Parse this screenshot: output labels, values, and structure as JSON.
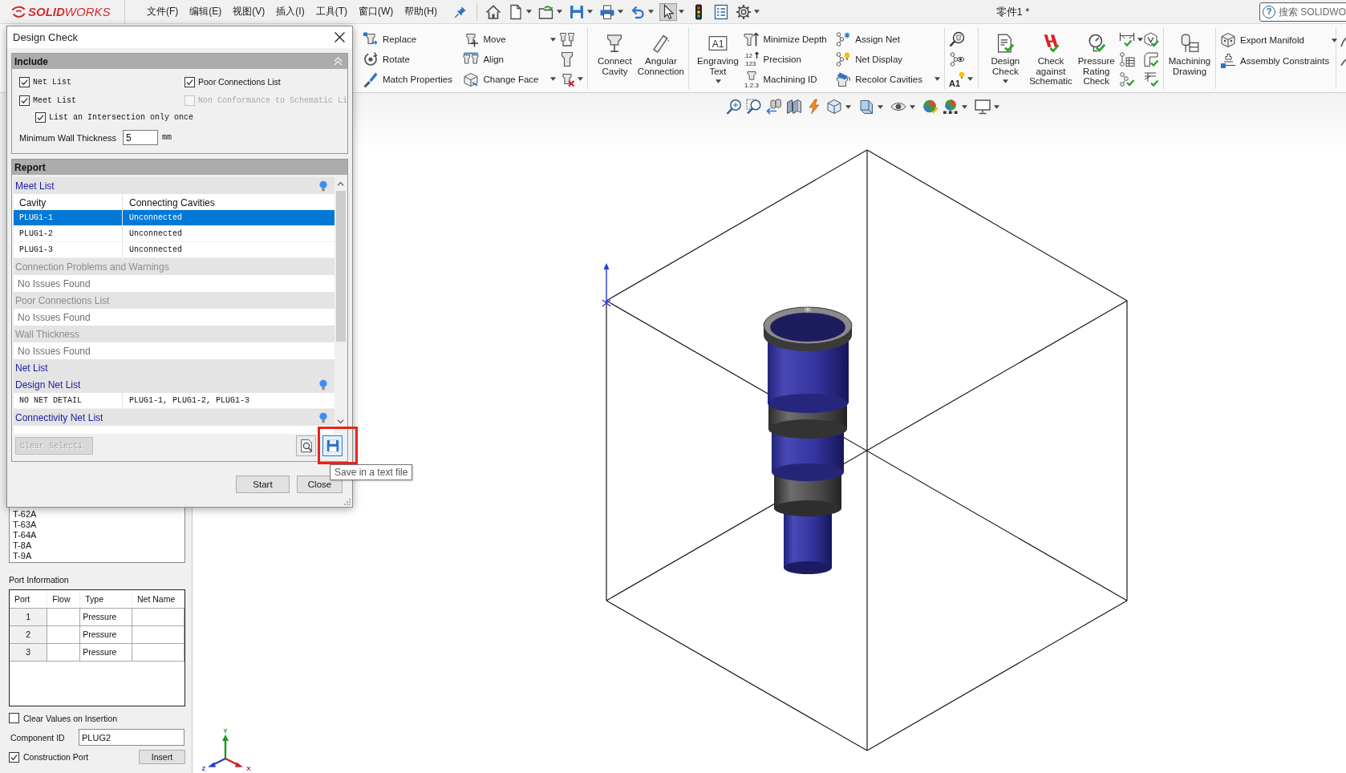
{
  "title_bar": {
    "logo": "**SOLID**WORKS",
    "menus": [
      "文件(F)",
      "编辑(E)",
      "视图(V)",
      "插入(I)",
      "工具(T)",
      "窗口(W)",
      "帮助(H)"
    ],
    "tools": [
      {
        "kind": "home",
        "dropdown": false,
        "selected": false
      },
      {
        "kind": "new",
        "dropdown": true,
        "selected": false
      },
      {
        "kind": "open",
        "dropdown": true,
        "selected": false
      },
      {
        "kind": "save",
        "dropdown": true,
        "selected": false
      },
      {
        "kind": "print",
        "dropdown": true,
        "selected": false
      },
      {
        "kind": "undo",
        "dropdown": true,
        "selected": false
      },
      {
        "kind": "select",
        "dropdown": true,
        "selected": true
      },
      {
        "kind": "rebuild",
        "dropdown": false,
        "selected": false
      },
      {
        "kind": "properties",
        "dropdown": false,
        "selected": false
      },
      {
        "kind": "options",
        "dropdown": true,
        "selected": false
      }
    ],
    "title": "零件1 *",
    "search": {
      "help": "?",
      "placeholder": "搜索 SOLIDWO"
    }
  },
  "ribbon": {
    "groups": [
      {
        "columns": [
          {
            "kind": "small",
            "items": [
              {
                "kind": "replace",
                "label": "Replace",
                "dropdown": false
              },
              {
                "kind": "rotate",
                "label": "Rotate",
                "dropdown": false
              },
              {
                "kind": "match",
                "label": "Match Properties",
                "dropdown": false
              }
            ]
          },
          {
            "kind": "small",
            "items": [
              {
                "kind": "move",
                "label": "Move",
                "dropdown": true
              },
              {
                "kind": "align",
                "label": "Align",
                "dropdown": false
              },
              {
                "kind": "face",
                "label": "Change Face",
                "dropdown": true
              }
            ]
          },
          {
            "kind": "small",
            "items": [
              {
                "kind": "pair",
                "dropdown": false
              },
              {
                "kind": "cup",
                "dropdown": false
              },
              {
                "kind": "remove",
                "dropdown": true
              }
            ]
          }
        ]
      },
      {
        "columns": [
          {
            "kind": "large",
            "items": [
              {
                "kind": "connect",
                "label": "Connect Cavity",
                "dropdown": false
              }
            ]
          },
          {
            "kind": "large",
            "items": [
              {
                "kind": "angular",
                "label": "Angular Connection",
                "dropdown": false
              }
            ]
          }
        ]
      },
      {
        "columns": [
          {
            "kind": "large",
            "items": [
              {
                "kind": "engrave",
                "label": "Engraving Text",
                "icon_lines": [
                  "A1"
                ],
                "dropdown": true
              }
            ]
          },
          {
            "kind": "small",
            "items": [
              {
                "kind": "depth",
                "label": "Minimize Depth",
                "dropdown": false
              },
              {
                "kind": "precision",
                "label": "Precision",
                "icon_lines": [
                  ".12",
                  ".123"
                ],
                "dropdown": false
              },
              {
                "kind": "numbering",
                "label": "Machining ID",
                "icon_lines": [
                  "1.2.3"
                ],
                "dropdown": false
              }
            ]
          },
          {
            "kind": "small",
            "items": [
              {
                "kind": "assign",
                "label": "Assign Net",
                "dropdown": false
              },
              {
                "kind": "netdisplay",
                "label": "Net Display",
                "dropdown": false
              },
              {
                "kind": "recolor",
                "label": "Recolor Cavities",
                "dropdown": true
              }
            ]
          }
        ]
      },
      {
        "columns": [
          {
            "kind": "small",
            "items": [
              {
                "kind": "find",
                "dropdown": false
              },
              {
                "kind": "watch",
                "dropdown": false
              },
              {
                "kind": "annotate",
                "icon_lines": [
                  "A1"
                ],
                "dropdown": true
              }
            ]
          }
        ]
      },
      {
        "columns": [
          {
            "kind": "large",
            "items": [
              {
                "kind": "check",
                "label": "Design Check",
                "dropdown": true
              }
            ]
          },
          {
            "kind": "large",
            "items": [
              {
                "kind": "schematic",
                "label": "Check against Schematic",
                "dropdown": false
              }
            ]
          },
          {
            "kind": "large",
            "items": [
              {
                "kind": "pressure",
                "label": "Pressure Rating Check",
                "dropdown": false
              }
            ]
          },
          {
            "kind": "small",
            "items": [
              {
                "kind": "dimension",
                "dropdown": true
              },
              {
                "kind": "nettable",
                "dropdown": false
              },
              {
                "kind": "netcheck",
                "dropdown": false
              }
            ]
          },
          {
            "kind": "small",
            "items": [
              {
                "kind": "cube",
                "dropdown": false
              },
              {
                "kind": "pipe",
                "dropdown": false
              },
              {
                "kind": "hatch",
                "dropdown": false
              }
            ]
          }
        ]
      },
      {
        "columns": [
          {
            "kind": "large",
            "items": [
              {
                "kind": "drawing",
                "label": "Machining Drawing",
                "dropdown": false
              }
            ]
          }
        ]
      },
      {
        "columns": [
          {
            "kind": "small",
            "items": [
              {
                "kind": "export",
                "label": "Export Manifold",
                "dropdown": true
              },
              {
                "kind": "constraints",
                "label": "Assembly Constraints",
                "dropdown": false
              }
            ]
          }
        ]
      },
      {
        "columns": [
          {
            "kind": "small",
            "items": [
              {
                "kind": "sketch",
                "dropdown": false
              },
              {
                "kind": "curve",
                "dropdown": false
              }
            ]
          }
        ]
      }
    ]
  },
  "design_check": {
    "title": "Design Check",
    "include": {
      "title": "Include",
      "expanded": true,
      "columns": [
        {
          "options": [
            {
              "label": "Net List",
              "checked": true,
              "disabled": false
            },
            {
              "label": "Meet List",
              "checked": true,
              "disabled": false,
              "children": [
                {
                  "label": "List an Intersection only once",
                  "checked": true,
                  "disabled": false
                }
              ]
            }
          ]
        },
        {
          "options": [
            {
              "label": "Poor Connections List",
              "checked": true,
              "disabled": false
            },
            {
              "label": "Non Conformance to Schematic Li",
              "checked": false,
              "disabled": true
            }
          ]
        }
      ],
      "wall_thickness": {
        "label": "Minimum Wall Thickness",
        "value": "5",
        "unit": "mm"
      }
    },
    "report": {
      "title": "Report",
      "sections": [
        {
          "kind": "heading",
          "label": "Meet List",
          "disabled": false,
          "icon": true
        },
        {
          "kind": "table",
          "columns": [
            "Cavity",
            "Connecting Cavities"
          ],
          "rows": [
            {
              "cells": [
                "PLUG1-1",
                "Unconnected"
              ],
              "selected": true
            },
            {
              "cells": [
                "PLUG1-2",
                "Unconnected"
              ],
              "selected": false
            },
            {
              "cells": [
                "PLUG1-3",
                "Unconnected"
              ],
              "selected": false
            }
          ]
        },
        {
          "kind": "heading",
          "label": "Connection Problems and Warnings",
          "disabled": true,
          "icon": false
        },
        {
          "kind": "message",
          "text": "No Issues Found"
        },
        {
          "kind": "heading",
          "label": "Poor Connections List",
          "disabled": true,
          "icon": false
        },
        {
          "kind": "message",
          "text": "No Issues Found"
        },
        {
          "kind": "heading",
          "label": "Wall Thickness",
          "disabled": true,
          "icon": false
        },
        {
          "kind": "message",
          "text": "No Issues Found"
        },
        {
          "kind": "heading",
          "label": "Net List",
          "disabled": false,
          "icon": false
        },
        {
          "kind": "heading",
          "label": "Design Net List",
          "disabled": false,
          "icon": true
        },
        {
          "kind": "table",
          "rows": [
            {
              "cells": [
                "NO NET DETAIL",
                "PLUG1-1, PLUG1-2, PLUG1-3"
              ],
              "selected": false
            }
          ]
        },
        {
          "kind": "heading",
          "label": "Connectivity Net List",
          "disabled": false,
          "icon": true
        }
      ],
      "clear_selection": {
        "label": "Clear Selecti",
        "disabled": true
      },
      "tools": [
        {
          "kind": "preview",
          "hovered": false,
          "highlighted": false
        },
        {
          "kind": "save",
          "hovered": true,
          "highlighted": true,
          "tooltip": "Save in a text file"
        }
      ]
    },
    "buttons": [
      "Start",
      "Close"
    ]
  },
  "property_panel": {
    "list_items": [
      "T-62A",
      "T-63A",
      "T-64A",
      "T-8A",
      "T-9A"
    ],
    "port_information": {
      "title": "Port Information",
      "columns": [
        "Port",
        "Flow",
        "Type",
        "Net Name"
      ],
      "rows": [
        {
          "port": "1",
          "type": "Pressure"
        },
        {
          "port": "2",
          "type": "Pressure"
        },
        {
          "port": "3",
          "type": "Pressure"
        }
      ]
    },
    "clear_values": {
      "label": "Clear Values on Insertion",
      "checked": false
    },
    "component_id": {
      "label": "Component ID",
      "value": "PLUG2"
    },
    "construction_port": {
      "label": "Construction Port",
      "checked": true
    },
    "insert_button": "Insert"
  },
  "viewport": {
    "view_tools": [
      {
        "kind": "fit",
        "dropdown": false
      },
      {
        "kind": "area",
        "dropdown": false
      },
      {
        "kind": "previous",
        "dropdown": false
      },
      {
        "kind": "section",
        "dropdown": false
      },
      {
        "kind": "annotation",
        "dropdown": false
      },
      {
        "kind": "orientation",
        "dropdown": true
      },
      {
        "kind": "style",
        "dropdown": true
      },
      {
        "kind": "visibility",
        "dropdown": true
      },
      {
        "kind": "appearance",
        "dropdown": false
      },
      {
        "kind": "scene",
        "dropdown": true
      },
      {
        "kind": "settings",
        "dropdown": true
      }
    ],
    "triad": {
      "x": "X",
      "y": "Y",
      "z": "Z"
    }
  }
}
